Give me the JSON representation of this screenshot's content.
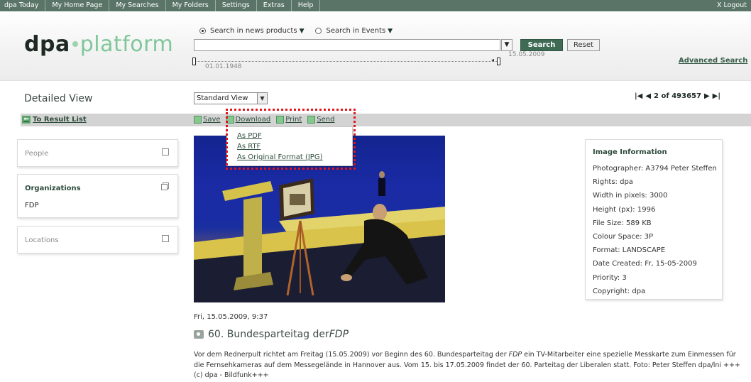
{
  "nav": {
    "items": [
      "dpa Today",
      "My Home Page",
      "My Searches",
      "My Folders",
      "Settings",
      "Extras",
      "Help"
    ],
    "logout": "X  Logout"
  },
  "logo": {
    "part1": "dpa",
    "part2": "platform"
  },
  "search": {
    "option_news": "Search in news products",
    "option_events": "Search in Events",
    "query": "",
    "search_label": "Search",
    "reset_label": "Reset",
    "date_start": "01.01.1948",
    "date_end": "15.05.2009",
    "advanced_label": "Advanced Search"
  },
  "view": {
    "title": "Detailed View",
    "selected_view": "Standard View",
    "pager_text": "2 of 493657"
  },
  "toolbar": {
    "back_label": "To Result List",
    "save": "Save",
    "download": "Download",
    "print": "Print",
    "send": "Send"
  },
  "download_menu": {
    "items": [
      "As PDF",
      "As RTF",
      "As Original Format (JPG)"
    ]
  },
  "panels": {
    "people": {
      "title": "People"
    },
    "organizations": {
      "title": "Organizations",
      "value": "FDP"
    },
    "locations": {
      "title": "Locations"
    }
  },
  "image_info": {
    "heading": "Image Information",
    "rows": [
      "Photographer: A3794 Peter Steffen",
      "Rights: dpa",
      "Width in pixels: 3000",
      "Height (px): 1996",
      "File Size: 589 KB",
      "Colour Space: 3P",
      "Format: LANDSCAPE",
      "Date Created: Fr, 15-05-2009",
      "Priority: 3",
      "Copyright: dpa"
    ]
  },
  "article": {
    "dateline": "Fri, 15.05.2009, 9:37",
    "headline_prefix": "60. Bundesparteitag der ",
    "headline_em": "FDP",
    "caption_1": "Vor dem Rednerpult richtet am Freitag (15.05.2009) vor Beginn des 60. Bundesparteitag der ",
    "caption_em": "FDP",
    "caption_2": " ein TV-Mitarbeiter eine spezielle Messkarte zum Einmessen für die Fernsehkameras auf dem Messegelände in Hannover aus. Vom 15. bis 17.05.2009 findet der 60. Parteitag der Liberalen statt. Foto: Peter Steffen dpa/lni +++(c) dpa - Bildfunk+++"
  },
  "colors": {
    "nav_bg": "#5a7567",
    "accent_green": "#3f6b55",
    "logo_green": "#7fc79a",
    "highlight_red": "#e1141e"
  }
}
